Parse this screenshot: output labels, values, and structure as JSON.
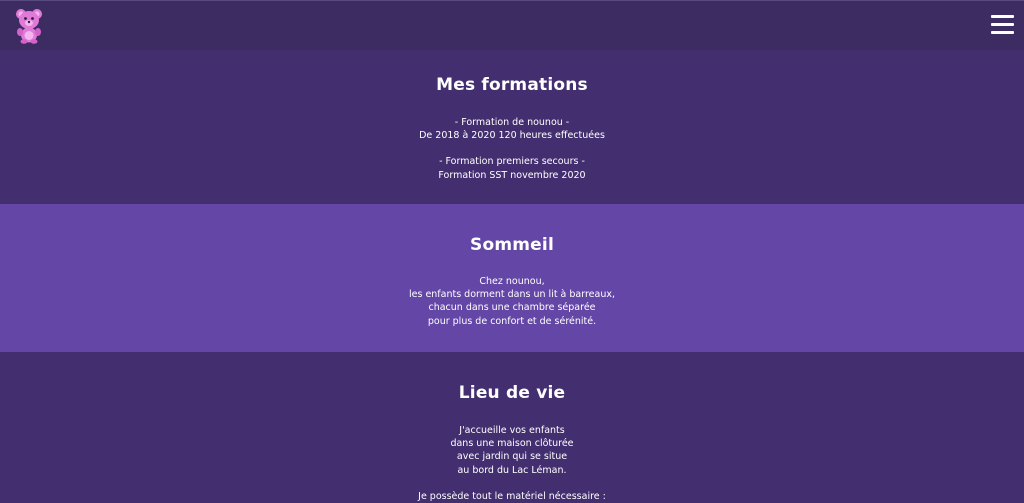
{
  "navbar": {
    "logo_icon": "teddy-bear-icon",
    "menu_icon": "hamburger-menu-icon"
  },
  "formations": {
    "title": "Mes formations",
    "lines_1": [
      "- Formation de nounou -",
      "De 2018 à 2020 120 heures effectuées"
    ],
    "lines_2": [
      "- Formation premiers secours -",
      "Formation SST novembre 2020"
    ]
  },
  "sommeil": {
    "title": "Sommeil",
    "lines": [
      "Chez nounou,",
      "les enfants dorment dans un lit à barreaux,",
      "chacun dans une chambre séparée",
      "pour plus de confort et de sérénité."
    ]
  },
  "lieu": {
    "title": "Lieu de vie",
    "lines_1": [
      "J'accueille vos enfants",
      "dans une maison clôturée",
      "avec jardin qui se situe",
      "au bord du Lac Léman."
    ],
    "lines_2": [
      "Je possède tout le matériel nécessaire :"
    ]
  },
  "colors": {
    "navbar": "#3c2c62",
    "dark_section": "#432f6f",
    "light_section": "#6446a6",
    "logo_pink": "#e07ad8"
  }
}
